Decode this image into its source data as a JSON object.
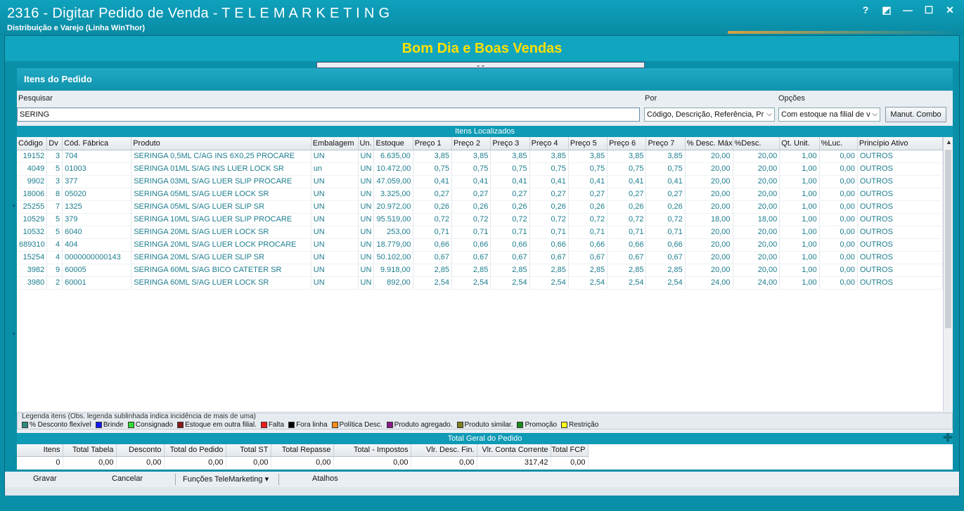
{
  "window": {
    "title": "2316 - Digitar Pedido de Venda - T E L E M A R K E T I N G",
    "subtitle": "Distribuição e Varejo (Linha WinThor)",
    "help": "?",
    "restore": "◩",
    "minimize": "—",
    "maximize": "☐",
    "close": "✕"
  },
  "greeting": "Bom Dia e Boas Vendas",
  "collapse_handle": "⌄⌄",
  "panel": {
    "title": "Itens do Pedido",
    "search_label": "Pesquisar",
    "search_value": "SERING",
    "por_label": "Por",
    "por_value": "Código, Descrição, Referência, Pr",
    "opcoes_label": "Opções",
    "opcoes_value": "Com estoque na filial de v",
    "manut_button": "Manut. Combo"
  },
  "grid": {
    "title": "Itens Localizados",
    "columns": [
      "Código",
      "Dv",
      "Cód. Fábrica",
      "Produto",
      "Embalagem",
      "Un.",
      "Estoque",
      "Preço 1",
      "Preço 2",
      "Preço 3",
      "Preço 4",
      "Preço 5",
      "Preço 6",
      "Preço 7",
      "% Desc. Máx",
      "%Desc.",
      "Qt. Unit.",
      "%Luc.",
      "Princípio Ativo"
    ],
    "rows": [
      [
        "19152",
        "3",
        "704",
        "SERINGA 0,5ML C/AG INS 6X0,25 PROCARE",
        "UN",
        "UN",
        "6.635,00",
        "3,85",
        "3,85",
        "3,85",
        "3,85",
        "3,85",
        "3,85",
        "3,85",
        "20,00",
        "20,00",
        "1,00",
        "0,00",
        "OUTROS"
      ],
      [
        "4049",
        "5",
        "01003",
        "SERINGA 01ML S/AG INS LUER LOCK SR",
        "un",
        "UN",
        "10.472,00",
        "0,75",
        "0,75",
        "0,75",
        "0,75",
        "0,75",
        "0,75",
        "0,75",
        "20,00",
        "20,00",
        "1,00",
        "0,00",
        "OUTROS"
      ],
      [
        "9902",
        "3",
        "377",
        "SERINGA 03ML S/AG LUER SLIP PROCARE",
        "UN",
        "UN",
        "47.059,00",
        "0,41",
        "0,41",
        "0,41",
        "0,41",
        "0,41",
        "0,41",
        "0,41",
        "20,00",
        "20,00",
        "1,00",
        "0,00",
        "OUTROS"
      ],
      [
        "18006",
        "8",
        "05020",
        "SERINGA 05ML S/AG LUER LOCK SR",
        "UN",
        "UN",
        "3.325,00",
        "0,27",
        "0,27",
        "0,27",
        "0,27",
        "0,27",
        "0,27",
        "0,27",
        "20,00",
        "20,00",
        "1,00",
        "0,00",
        "OUTROS"
      ],
      [
        "25255",
        "7",
        "1325",
        "SERINGA 05ML S/AG LUER SLIP SR",
        "UN",
        "UN",
        "20.972,00",
        "0,26",
        "0,26",
        "0,26",
        "0,26",
        "0,26",
        "0,26",
        "0,26",
        "20,00",
        "20,00",
        "1,00",
        "0,00",
        "OUTROS"
      ],
      [
        "10529",
        "5",
        "379",
        "SERINGA 10ML S/AG LUER SLIP PROCARE",
        "UN",
        "UN",
        "95.519,00",
        "0,72",
        "0,72",
        "0,72",
        "0,72",
        "0,72",
        "0,72",
        "0,72",
        "18,00",
        "18,00",
        "1,00",
        "0,00",
        "OUTROS"
      ],
      [
        "10532",
        "5",
        "6040",
        "SERINGA 20ML S/AG LUER LOCK SR",
        "UN",
        "UN",
        "253,00",
        "0,71",
        "0,71",
        "0,71",
        "0,71",
        "0,71",
        "0,71",
        "0,71",
        "20,00",
        "20,00",
        "1,00",
        "0,00",
        "OUTROS"
      ],
      [
        "689310",
        "4",
        "404",
        "SERINGA 20ML S/AG LUER LOCK PROCARE",
        "UN",
        "UN",
        "18.779,00",
        "0,66",
        "0,66",
        "0,66",
        "0,66",
        "0,66",
        "0,66",
        "0,66",
        "20,00",
        "20,00",
        "1,00",
        "0,00",
        "OUTROS"
      ],
      [
        "15254",
        "4",
        "0000000000143",
        "SERINGA 20ML S/AG LUER SLIP SR",
        "UN",
        "UN",
        "50.102,00",
        "0,67",
        "0,67",
        "0,67",
        "0,67",
        "0,67",
        "0,67",
        "0,67",
        "20,00",
        "20,00",
        "1,00",
        "0,00",
        "OUTROS"
      ],
      [
        "3982",
        "9",
        "60005",
        "SERINGA 60ML S/AG BICO CATETER SR",
        "UN",
        "UN",
        "9.918,00",
        "2,85",
        "2,85",
        "2,85",
        "2,85",
        "2,85",
        "2,85",
        "2,85",
        "20,00",
        "20,00",
        "1,00",
        "0,00",
        "OUTROS"
      ],
      [
        "3980",
        "2",
        "60001",
        "SERINGA 60ML S/AG LUER LOCK SR",
        "UN",
        "UN",
        "892,00",
        "2,54",
        "2,54",
        "2,54",
        "2,54",
        "2,54",
        "2,54",
        "2,54",
        "24,00",
        "24,00",
        "1,00",
        "0,00",
        "OUTROS"
      ]
    ]
  },
  "legend": {
    "title": "Legenda itens (Obs. legenda sublinhada indica incidência de mais de uma)",
    "items": [
      {
        "label": "% Desconto flexível",
        "color": "#2e8b80"
      },
      {
        "label": "Brinde",
        "color": "#1a1aff"
      },
      {
        "label": "Consignado",
        "color": "#33dd33"
      },
      {
        "label": "Estoque em outra filial.",
        "color": "#8b1a1a"
      },
      {
        "label": "Falta",
        "color": "#ff1a1a"
      },
      {
        "label": "Fora linha",
        "color": "#000000"
      },
      {
        "label": "Política Desc.",
        "color": "#ff8c1a"
      },
      {
        "label": "Produto agregado.",
        "color": "#8b1a8b"
      },
      {
        "label": "Produto similar.",
        "color": "#808020"
      },
      {
        "label": "Promoção",
        "color": "#1a8b1a"
      },
      {
        "label": "Restrição",
        "color": "#ffff1a"
      }
    ]
  },
  "totals": {
    "title": "Total Geral do Pedido",
    "columns": [
      "Itens",
      "Total Tabela",
      "Desconto",
      "Total do Pedido",
      "Total ST",
      "Total Repasse",
      "Total - Impostos",
      "Vlr. Desc. Fin.",
      "Vlr. Conta Corrente",
      "Total FCP"
    ],
    "values": [
      "0",
      "0,00",
      "0,00",
      "0,00",
      "0,00",
      "0,00",
      "0,00",
      "0,00",
      "317,42",
      "0,00"
    ]
  },
  "bottom": {
    "gravar": "Gravar",
    "cancelar": "Cancelar",
    "funcoes": "Funções TeleMarketing",
    "atalhos": "Atalhos"
  }
}
